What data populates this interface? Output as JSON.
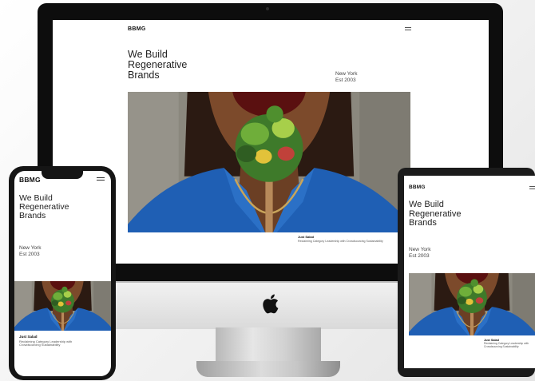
{
  "site": {
    "logo": "BBMG",
    "headline_line1": "We Build",
    "headline_line2": "Regenerative",
    "headline_line3": "Brands",
    "location": "New York",
    "established": "Est 2003",
    "case_title": "Just Salad",
    "case_caption": "Reclaiming Category Leadership with Crowdsourcing Sustainability",
    "case_caption_line1": "Reclaiming Category Leadership with",
    "case_caption_line2": "Crowdsourcing Sustainability"
  },
  "icons": {
    "menu": "hamburger-menu-icon",
    "brand": "apple-logo-icon"
  },
  "colors": {
    "shirt_blue": "#1f5fb4",
    "skin": "#7a4a2c",
    "device_frame": "#0d0d0d",
    "background": "#f0f0f0"
  }
}
